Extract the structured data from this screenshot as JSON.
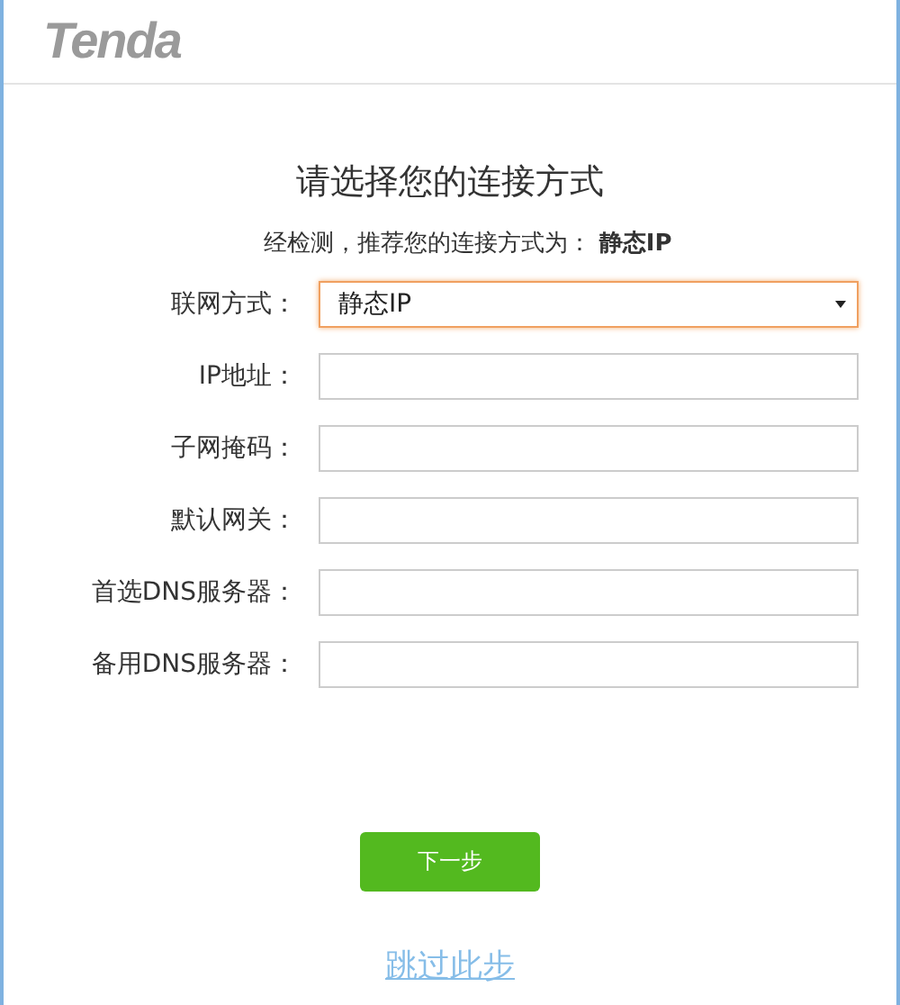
{
  "header": {
    "logo": "Tenda"
  },
  "title": "请选择您的连接方式",
  "detected": "经检测，推荐您的连接方式为： **静态IP**",
  "fields": [
    {
      "kind": "select",
      "label": "联网方式：",
      "value": "静态IP",
      "focused": true
    },
    {
      "kind": "input",
      "label": "IP地址：",
      "focused": false
    },
    {
      "kind": "input",
      "label": "子网掩码：",
      "focused": false
    },
    {
      "kind": "input",
      "label": "默认网关：",
      "focused": false
    },
    {
      "kind": "input",
      "label": "首选DNS服务器：",
      "focused": false
    },
    {
      "kind": "input",
      "label": "备用DNS服务器：",
      "focused": false
    }
  ],
  "next_button": "下一步",
  "skip_link": "跳过此步"
}
